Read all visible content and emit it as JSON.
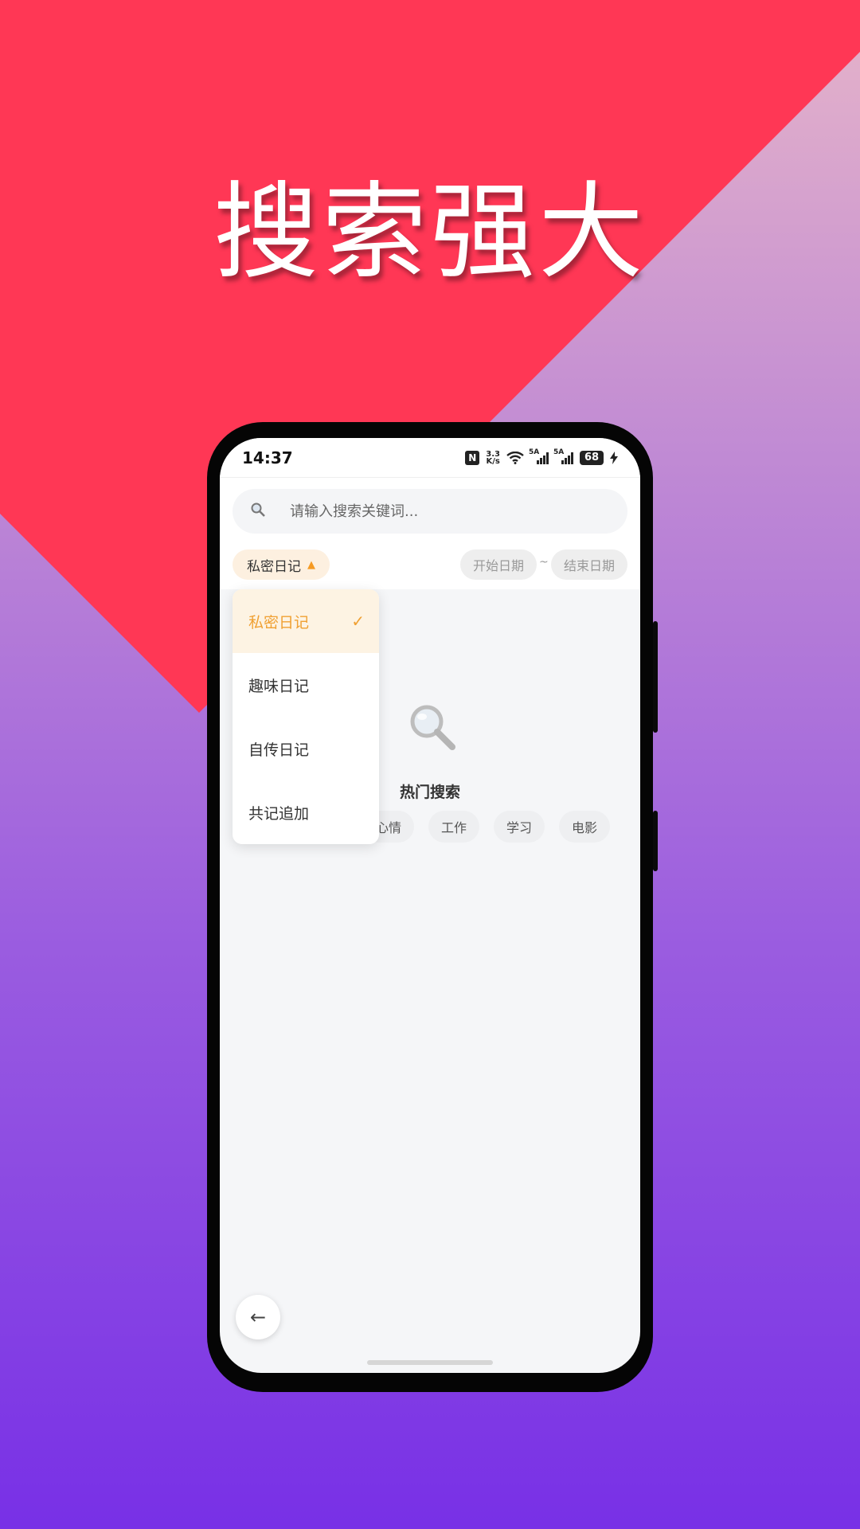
{
  "promo": {
    "headline": "搜索强大"
  },
  "statusbar": {
    "time": "14:37",
    "nfc": "N",
    "speed_value": "3.3",
    "speed_unit": "K/s",
    "sim1": "5A",
    "sim2": "5A",
    "battery": "68"
  },
  "search": {
    "placeholder": "请输入搜索关键词...",
    "value": ""
  },
  "filter": {
    "selected": "私密日记",
    "start_date": "开始日期",
    "end_date": "结束日期",
    "separator": "~"
  },
  "dropdown": {
    "items": [
      {
        "label": "私密日记",
        "selected": true
      },
      {
        "label": "趣味日记"
      },
      {
        "label": "自传日记"
      },
      {
        "label": "共记追加"
      }
    ],
    "check": "✓"
  },
  "hot": {
    "title": "热门搜索",
    "tags": [
      "心情",
      "工作",
      "学习",
      "电影"
    ]
  },
  "nav": {
    "back_icon": "arrow-left-icon",
    "back_glyph": "←"
  },
  "colors": {
    "accent_red": "#ff3755",
    "accent_orange": "#f0a032"
  }
}
